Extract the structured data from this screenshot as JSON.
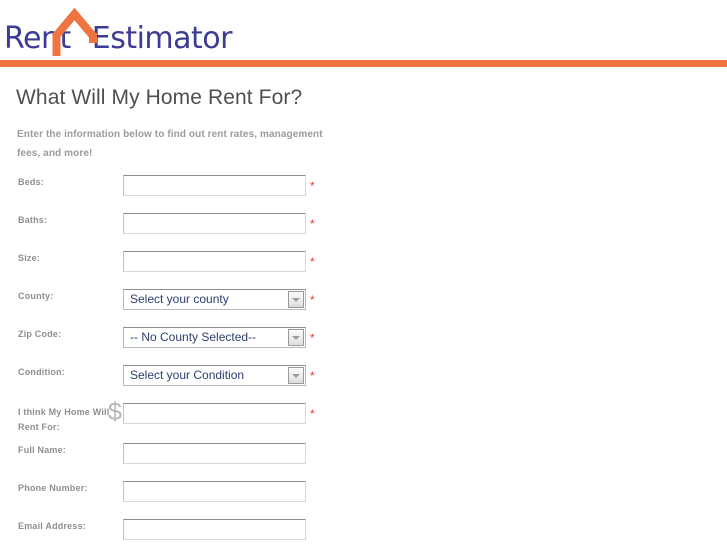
{
  "header": {
    "logo": {
      "word1": "Rent",
      "word2": "Estimator",
      "icon": "house-roof-icon",
      "text_color": "#3c3c96",
      "icon_color": "#ef7440"
    },
    "divider_color": "#ef7440"
  },
  "main": {
    "title": "What Will My Home Rent For?",
    "subtitle": "Enter the information below to find out rent rates, management fees, and more!",
    "required_marker": "*",
    "required_color": "#ef3b3b",
    "currency_symbol": "$"
  },
  "form": {
    "fields": [
      {
        "name": "beds",
        "label": "Beds:",
        "type": "text",
        "value": "",
        "required": true
      },
      {
        "name": "baths",
        "label": "Baths:",
        "type": "text",
        "value": "",
        "required": true
      },
      {
        "name": "size",
        "label": "Size:",
        "type": "text",
        "value": "",
        "required": true
      },
      {
        "name": "county",
        "label": "County:",
        "type": "select",
        "value": "Select your county",
        "required": true
      },
      {
        "name": "zip-code",
        "label": "Zip Code:",
        "type": "select",
        "value": "-- No County Selected--",
        "required": true
      },
      {
        "name": "condition",
        "label": "Condition:",
        "type": "select",
        "value": "Select your Condition",
        "required": true
      },
      {
        "name": "rent-guess",
        "label": "I think My Home Will Rent For:",
        "type": "currency",
        "value": "",
        "required": true
      },
      {
        "name": "full-name",
        "label": "Full Name:",
        "type": "text",
        "value": "",
        "required": false
      },
      {
        "name": "phone",
        "label": "Phone Number:",
        "type": "text",
        "value": "",
        "required": false
      },
      {
        "name": "email",
        "label": "Email Address:",
        "type": "text",
        "value": "",
        "required": false
      }
    ]
  }
}
